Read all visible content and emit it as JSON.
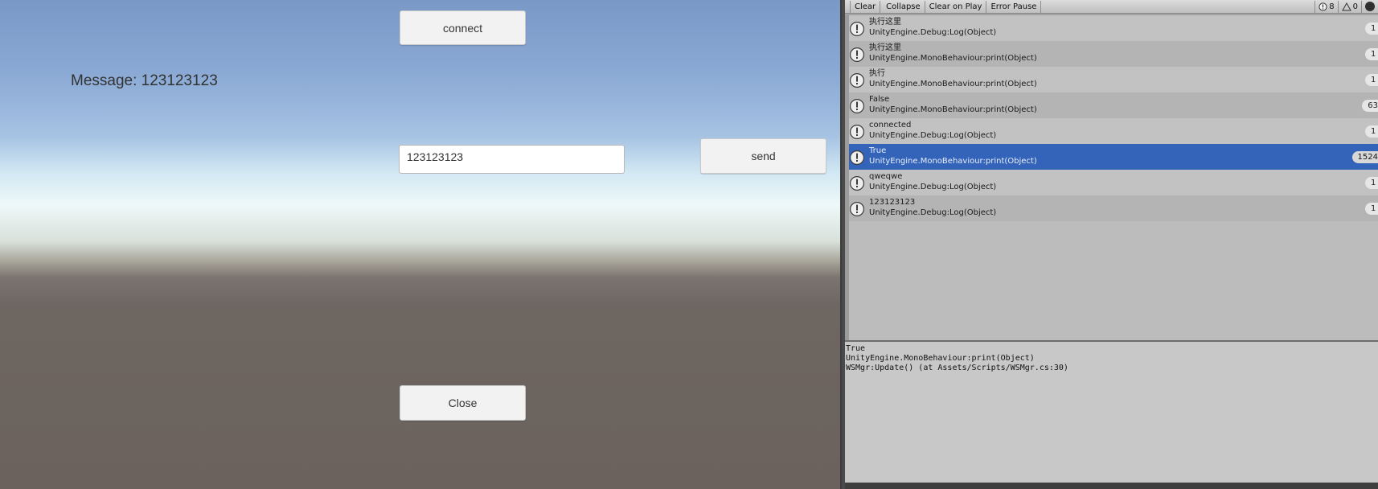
{
  "game": {
    "connect_label": "connect",
    "send_label": "send",
    "close_label": "Close",
    "message_text": "Message: 123123123",
    "input_value": "123123123"
  },
  "console": {
    "toolbar": {
      "clear": "Clear",
      "collapse": "Collapse",
      "clear_on_play": "Clear on Play",
      "error_pause": "Error Pause",
      "info_count": "8",
      "warning_count": "0"
    },
    "logs": [
      {
        "message": "执行这里",
        "source": "UnityEngine.Debug:Log(Object)",
        "count": "1",
        "selected": false
      },
      {
        "message": "执行这里",
        "source": "UnityEngine.MonoBehaviour:print(Object)",
        "count": "1",
        "selected": false
      },
      {
        "message": "执行",
        "source": "UnityEngine.MonoBehaviour:print(Object)",
        "count": "1",
        "selected": false
      },
      {
        "message": "False",
        "source": "UnityEngine.MonoBehaviour:print(Object)",
        "count": "63",
        "selected": false
      },
      {
        "message": "connected",
        "source": "UnityEngine.Debug:Log(Object)",
        "count": "1",
        "selected": false
      },
      {
        "message": "True",
        "source": "UnityEngine.MonoBehaviour:print(Object)",
        "count": "1524",
        "selected": true
      },
      {
        "message": "qweqwe",
        "source": "UnityEngine.Debug:Log(Object)",
        "count": "1",
        "selected": false
      },
      {
        "message": "123123123",
        "source": "UnityEngine.Debug:Log(Object)",
        "count": "1",
        "selected": false
      }
    ],
    "detail": {
      "line1": "True",
      "line2": "UnityEngine.MonoBehaviour:print(Object)",
      "line3": "WSMgr:Update() (at Assets/Scripts/WSMgr.cs:30)"
    },
    "colors": {
      "selected_row": "#3464b9",
      "panel_bg": "#bcbcbc"
    }
  }
}
